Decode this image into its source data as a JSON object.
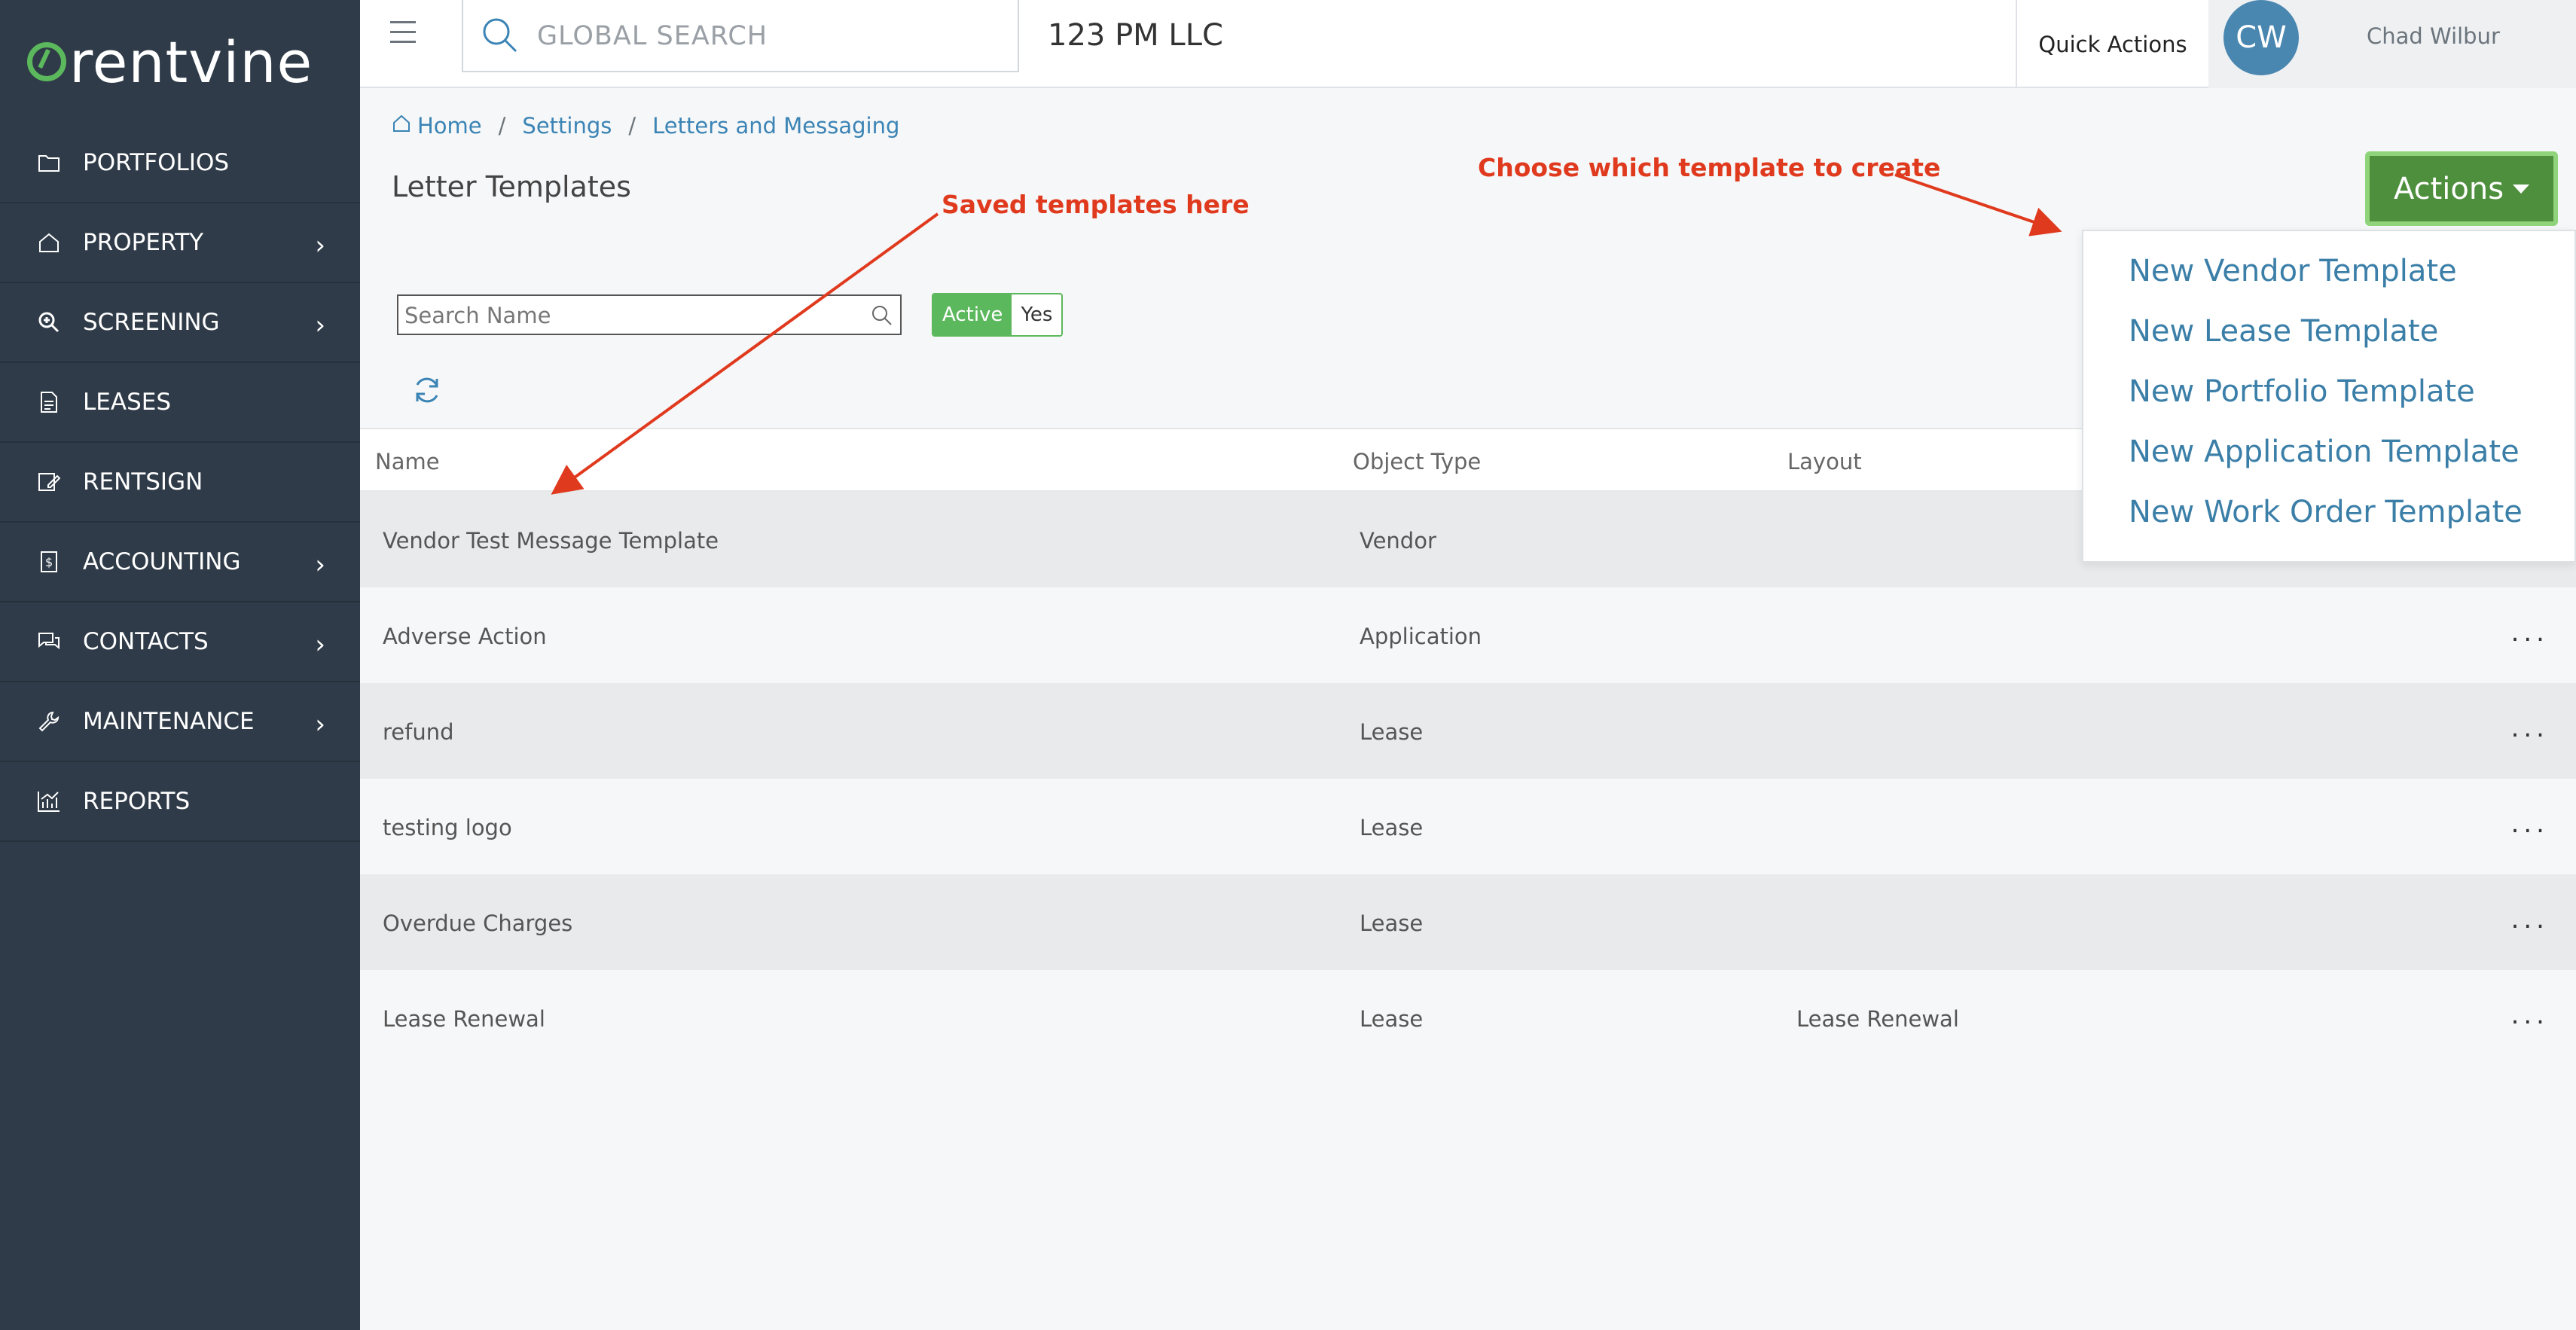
{
  "brand": {
    "logo_text": "rentvine"
  },
  "sidebar": {
    "items": [
      {
        "label": "PORTFOLIOS",
        "icon": "folder-icon",
        "has_submenu": false
      },
      {
        "label": "PROPERTY",
        "icon": "home-icon",
        "has_submenu": true
      },
      {
        "label": "SCREENING",
        "icon": "search-plus-icon",
        "has_submenu": true
      },
      {
        "label": "LEASES",
        "icon": "document-icon",
        "has_submenu": false
      },
      {
        "label": "RENTSIGN",
        "icon": "signature-icon",
        "has_submenu": false
      },
      {
        "label": "ACCOUNTING",
        "icon": "dollar-document-icon",
        "has_submenu": true
      },
      {
        "label": "CONTACTS",
        "icon": "chat-icon",
        "has_submenu": true
      },
      {
        "label": "MAINTENANCE",
        "icon": "wrench-icon",
        "has_submenu": true
      },
      {
        "label": "REPORTS",
        "icon": "chart-icon",
        "has_submenu": false
      }
    ],
    "submenu_glyph": "›"
  },
  "topbar": {
    "search_placeholder": "GLOBAL SEARCH",
    "company": "123 PM LLC",
    "quick_actions": "Quick Actions",
    "avatar_initials": "CW",
    "user_name": "Chad Wilbur"
  },
  "breadcrumb": [
    "Home",
    "Settings",
    "Letters and Messaging"
  ],
  "page_title": "Letter Templates",
  "filters": {
    "search_placeholder": "Search Name",
    "toggle_label": "Active",
    "toggle_value": "Yes"
  },
  "table": {
    "columns": [
      "Name",
      "Object Type",
      "Layout"
    ],
    "rows": [
      {
        "name": "Vendor Test Message Template",
        "object_type": "Vendor",
        "layout": ""
      },
      {
        "name": "Adverse Action",
        "object_type": "Application",
        "layout": ""
      },
      {
        "name": "refund",
        "object_type": "Lease",
        "layout": ""
      },
      {
        "name": "testing logo",
        "object_type": "Lease",
        "layout": ""
      },
      {
        "name": "Overdue Charges",
        "object_type": "Lease",
        "layout": ""
      },
      {
        "name": "Lease Renewal",
        "object_type": "Lease",
        "layout": "Lease Renewal"
      }
    ],
    "row_menu_glyph": "..."
  },
  "actions": {
    "label": "Actions",
    "menu": [
      "New Vendor Template",
      "New Lease Template",
      "New Portfolio Template",
      "New Application Template",
      "New Work Order Template"
    ]
  },
  "annotations": {
    "saved_templates": "Saved templates here",
    "choose_template": "Choose which template to create"
  },
  "colors": {
    "sidebar_bg": "#2f3b48",
    "brand_green": "#5cb85c",
    "actions_green": "#4e8f3d",
    "link_blue": "#3b84b5",
    "annotation_red": "#e03a1e"
  }
}
